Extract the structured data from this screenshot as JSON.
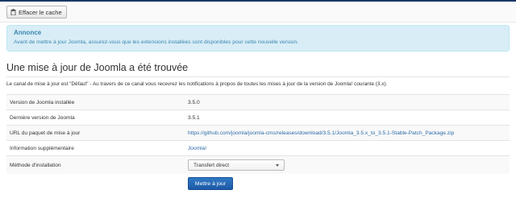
{
  "toolbar": {
    "clear_cache_label": "Effacer le cache"
  },
  "alert": {
    "title": "Annonce",
    "text": "Avant de mettre à jour Joomla, assurez-vous que les extensions installées sont disponibles pour cette nouvelle version."
  },
  "heading": "Une mise à jour de Joomla a été trouvée",
  "description": "Le canal de mise à jour est \"Défaut\" - Au travers de ce canal vous recevrez les notifications à propos de toutes les mises à jour de la version de Joomla! courante (3.x).",
  "rows": [
    {
      "label": "Version de Joomla installée",
      "value": "3.5.0"
    },
    {
      "label": "Dernière version de Joomla",
      "value": "3.5.1"
    },
    {
      "label": "URL du paquet de mise à jour",
      "value": "https://github.com/joomla/joomla-cms/releases/download/3.5.1/Joomla_3.5.x_to_3.5.1-Stable-Patch_Package.zip"
    },
    {
      "label": "Information supplémentaire",
      "value": "Joomla!"
    },
    {
      "label": "Méthode d'installation",
      "value": "Transfert direct"
    }
  ],
  "update_button_label": "Mettre à jour",
  "colors": {
    "accent": "#2b6ba8",
    "alert_bg": "#d9edf7",
    "alert_text": "#3a87ad",
    "button": "#2f78c4"
  },
  "icons": {
    "clear_cache": "trash-icon",
    "select_caret": "caret-down-icon"
  }
}
